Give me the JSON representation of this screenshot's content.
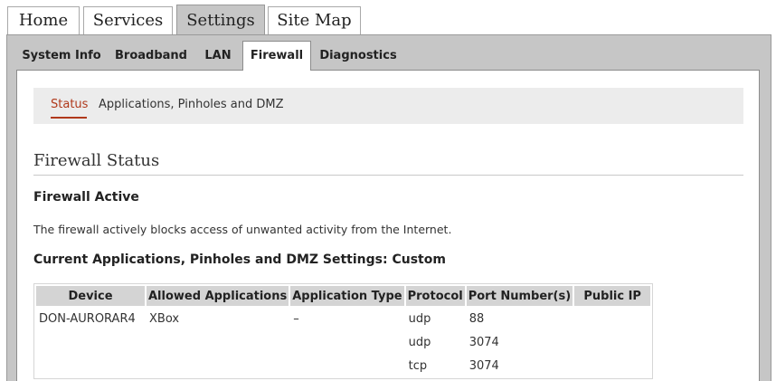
{
  "top_tabs": [
    "Home",
    "Services",
    "Settings",
    "Site Map"
  ],
  "sub_tabs": [
    "System Info",
    "Broadband",
    "LAN",
    "Firewall",
    "Diagnostics"
  ],
  "nav": {
    "status": "Status",
    "apps": "Applications, Pinholes and DMZ"
  },
  "section_title": "Firewall Status",
  "firewall_active": "Firewall Active",
  "description": "The firewall actively blocks access of unwanted activity from the Internet.",
  "current_settings": "Current Applications, Pinholes and DMZ Settings: Custom",
  "table": {
    "headers": [
      "Device",
      "Allowed Applications",
      "Application Type",
      "Protocol",
      "Port Number(s)",
      "Public IP"
    ],
    "rows": [
      [
        "DON-AURORAR4",
        "XBox",
        "–",
        "udp",
        "88",
        ""
      ],
      [
        "",
        "",
        "",
        "udp",
        "3074",
        ""
      ],
      [
        "",
        "",
        "",
        "tcp",
        "3074",
        ""
      ]
    ]
  },
  "colors": {
    "accent": "#b0391b",
    "frame": "#c6c6c6",
    "nav_bg": "#ececec"
  }
}
